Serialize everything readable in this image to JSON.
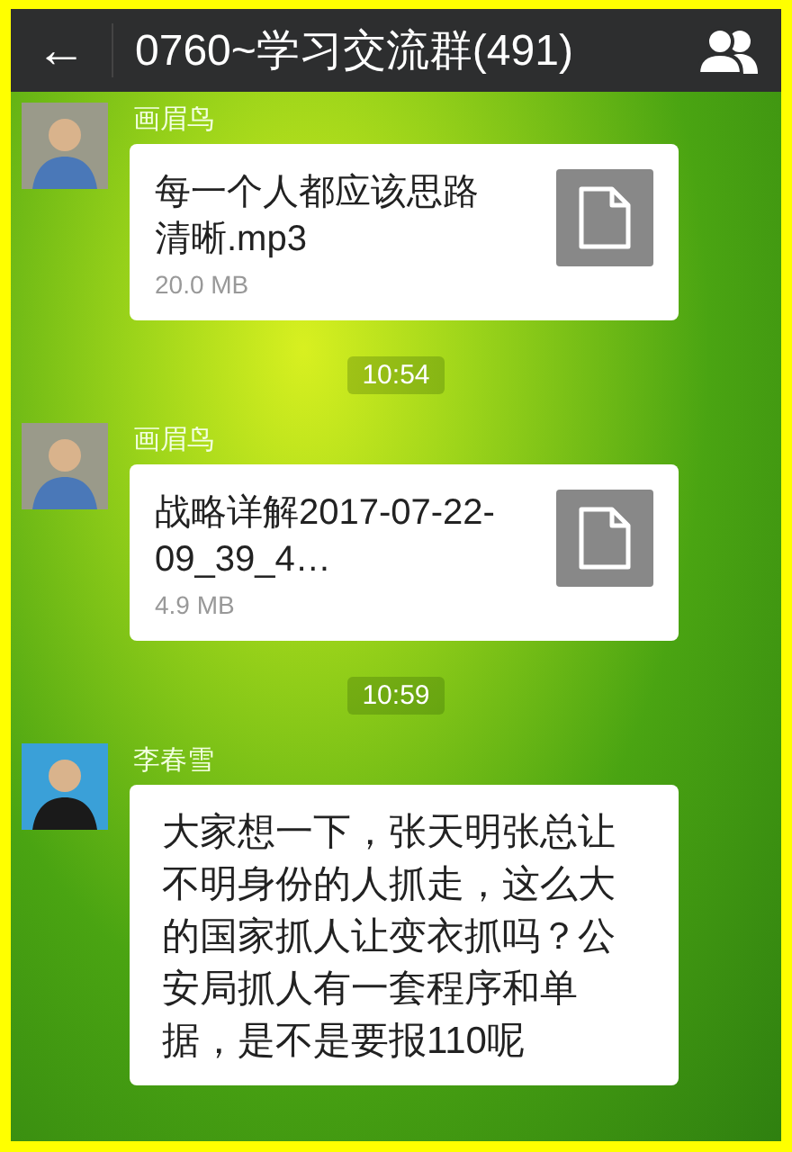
{
  "header": {
    "back": "←",
    "title": "0760~学习交流群(491)"
  },
  "messages": [
    {
      "kind": "file",
      "sender": "画眉鸟",
      "file_name": "每一个人都应该思路清晰.mp3",
      "file_size": "20.0 MB"
    },
    {
      "kind": "time",
      "text": "10:54"
    },
    {
      "kind": "file",
      "sender": "画眉鸟",
      "file_name": "战略详解2017-07-22-09_39_4…",
      "file_size": "4.9 MB"
    },
    {
      "kind": "time",
      "text": "10:59"
    },
    {
      "kind": "text",
      "sender": "李春雪",
      "text": "大家想一下，张天明张总让不明身份的人抓走，这么大的国家抓人让变衣抓吗？公安局抓人有一套程序和单据，是不是要报110呢"
    }
  ]
}
